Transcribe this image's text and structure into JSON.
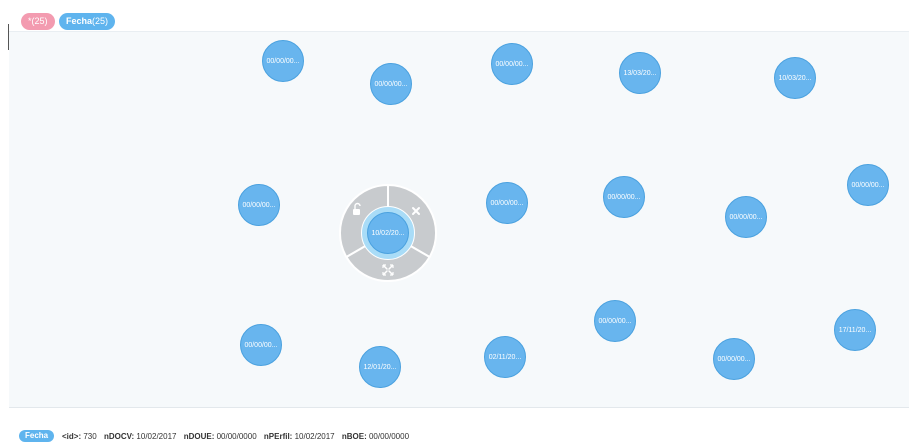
{
  "legend": {
    "all": {
      "label": "*",
      "count": "(25)",
      "color": "#f39bb0"
    },
    "fecha": {
      "label": "Fecha",
      "count": "(25)",
      "color": "#5fb4ee"
    }
  },
  "nodes": [
    "00/00/00...",
    "00/00/00...",
    "00/00/00...",
    "13/03/20...",
    "10/03/20...",
    "00/00/00...",
    "00/00/00...",
    "00/00/00...",
    "00/00/00...",
    "00/00/00...",
    "00/00/00...",
    "12/01/20...",
    "02/11/20...",
    "00/00/00...",
    "00/00/00...",
    "17/11/20..."
  ],
  "selected_node": {
    "label": "10/02/20..."
  },
  "ring_menu": {
    "lock_icon": "lock-icon",
    "close_icon": "close-icon",
    "expand_icon": "expand-icon"
  },
  "footer": {
    "label": "Fecha",
    "props": [
      {
        "key": "<id>:",
        "value": "730"
      },
      {
        "key": "nDOCV:",
        "value": "10/02/2017"
      },
      {
        "key": "nDOUE:",
        "value": "00/00/0000"
      },
      {
        "key": "nPErfil:",
        "value": "10/02/2017"
      },
      {
        "key": "nBOE:",
        "value": "00/00/0000"
      }
    ]
  }
}
